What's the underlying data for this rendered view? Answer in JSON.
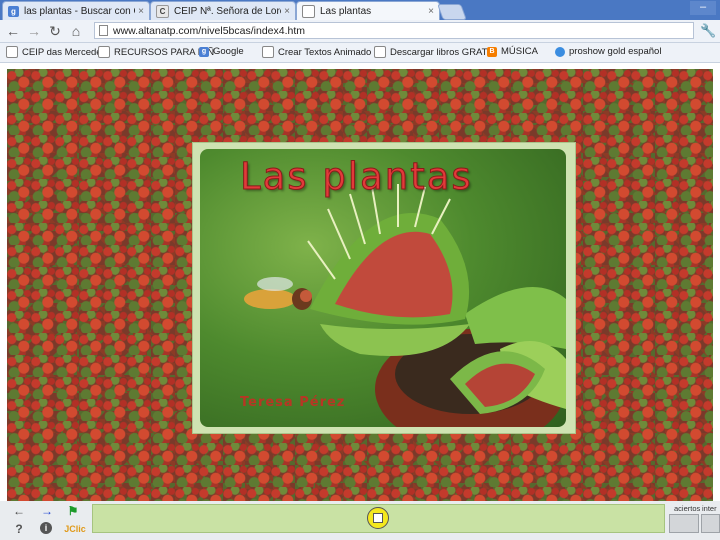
{
  "browser": {
    "tabs": [
      {
        "title": "las plantas - Buscar con Goog",
        "close": "×",
        "favicon": "google-icon"
      },
      {
        "title": "CEIP Nª. Señora de Loreto",
        "close": "×",
        "favicon": "site-icon"
      },
      {
        "title": "Las plantas",
        "close": "×",
        "favicon": "page-icon",
        "active": true
      }
    ],
    "minimize_label": "–",
    "url": "www.altanatp.com/nivel5bcas/index4.htm",
    "bookmarks": [
      {
        "label": "CEIP das Mercedes",
        "icon": "page-icon"
      },
      {
        "label": "RECURSOS PARA NIÑ",
        "icon": "page-icon"
      },
      {
        "label": "Google",
        "icon": "google-icon"
      },
      {
        "label": "Crear Textos Animado",
        "icon": "page-icon"
      },
      {
        "label": "Descargar libros GRAT",
        "icon": "page-icon"
      },
      {
        "label": "MÚSICA",
        "icon": "blogger-icon"
      },
      {
        "label": "proshow gold español",
        "icon": "globe-icon"
      }
    ]
  },
  "cover": {
    "title": "Las plantas",
    "author": "Teresa Pérez"
  },
  "jclic": {
    "prev_label": "←",
    "next_label": "→",
    "help_label": "?",
    "info_label": "i",
    "logo_label": "JClic",
    "counters": [
      {
        "label": "aciertos"
      },
      {
        "label": "inter"
      }
    ]
  }
}
